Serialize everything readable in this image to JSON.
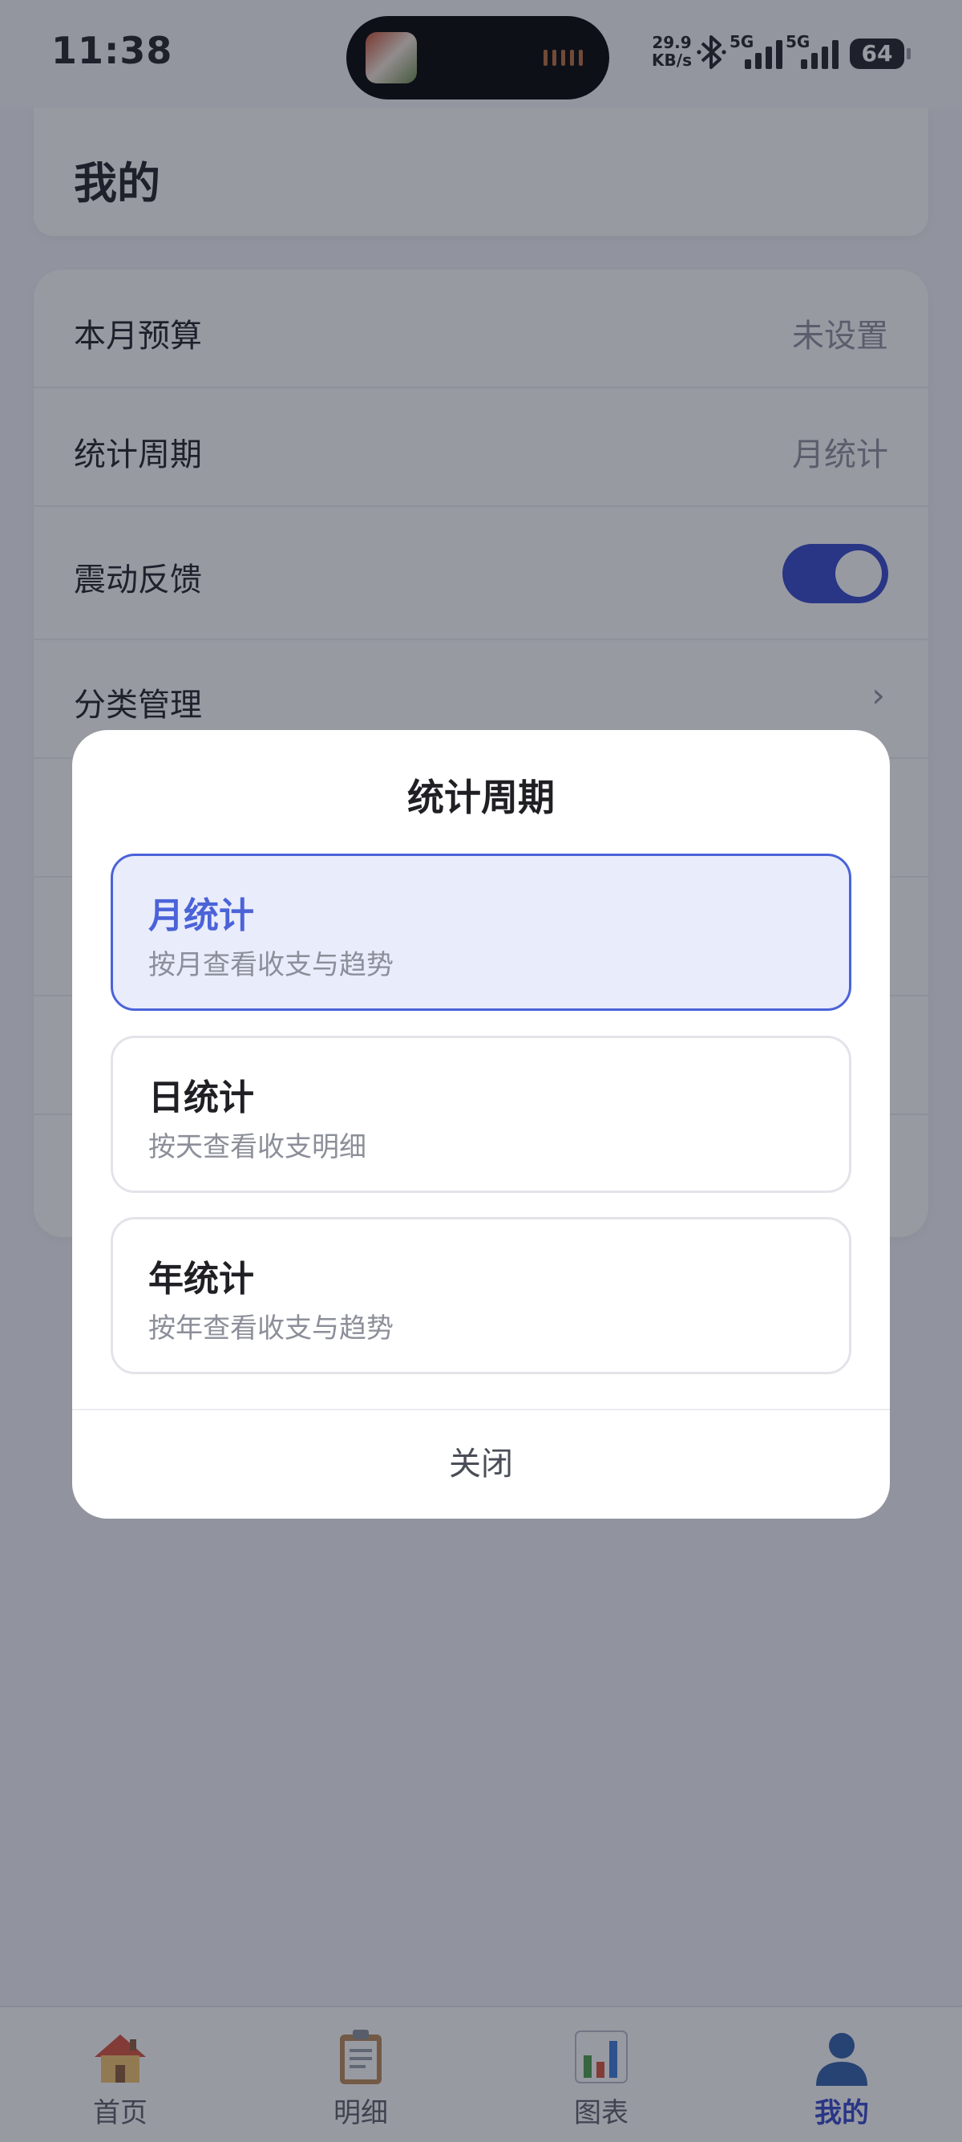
{
  "status_bar": {
    "time": "11:38",
    "net_speed_value": "29.9",
    "net_speed_unit": "KB/s",
    "sim1_label": "5G",
    "sim2_label": "5G",
    "battery": "64"
  },
  "header": {
    "title": "我的"
  },
  "settings": {
    "budget": {
      "label": "本月预算",
      "value": "未设置"
    },
    "period": {
      "label": "统计周期",
      "value": "月统计"
    },
    "vibration": {
      "label": "震动反馈",
      "enabled": true
    },
    "category": {
      "label": "分类管理"
    }
  },
  "dialog": {
    "title": "统计周期",
    "selected_index": 0,
    "options": [
      {
        "name": "月统计",
        "desc": "按月查看收支与趋势"
      },
      {
        "name": "日统计",
        "desc": "按天查看收支明细"
      },
      {
        "name": "年统计",
        "desc": "按年查看收支与趋势"
      }
    ],
    "close_label": "关闭"
  },
  "tabs": [
    {
      "label": "首页",
      "icon": "house-icon"
    },
    {
      "label": "明细",
      "icon": "clipboard-icon"
    },
    {
      "label": "图表",
      "icon": "bar-chart-icon"
    },
    {
      "label": "我的",
      "icon": "user-icon"
    }
  ],
  "active_tab_index": 3,
  "colors": {
    "accent": "#3346c9",
    "selected_option": "#4b63d8",
    "selected_option_bg": "#e9ecfb"
  }
}
